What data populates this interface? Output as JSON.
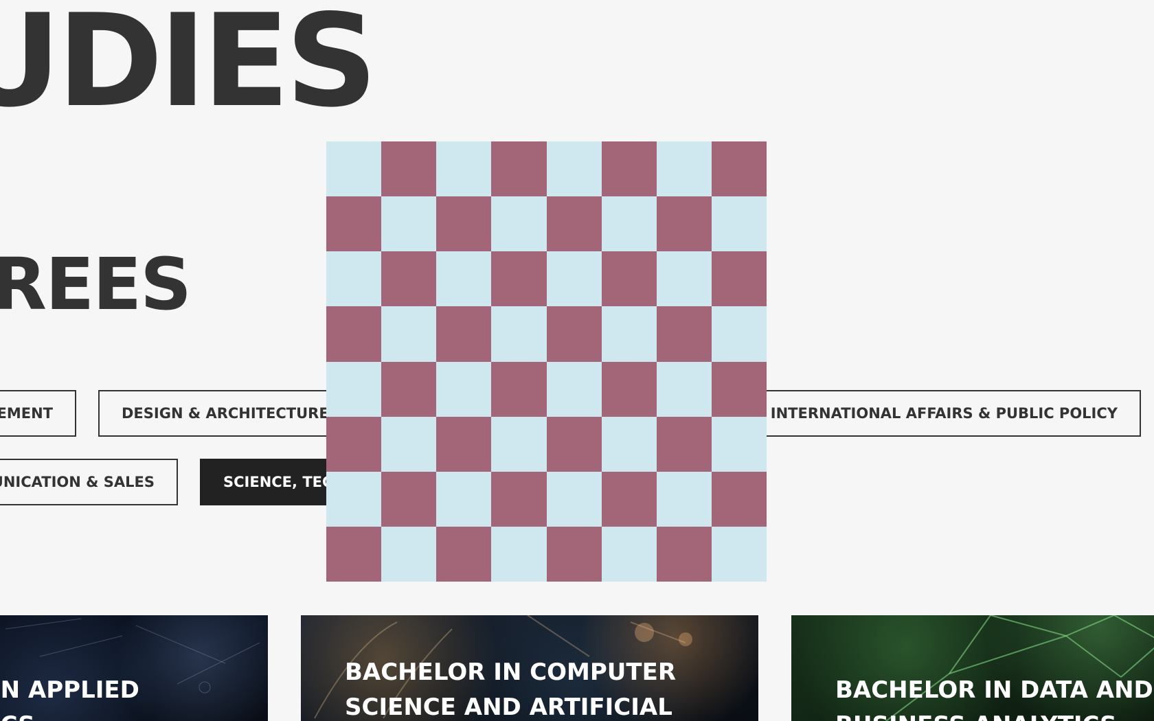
{
  "header": {
    "title": "UDIES"
  },
  "section": {
    "title": "REES"
  },
  "filters": {
    "management": "EMENT",
    "design": "DESIGN & ARCHITECTURE",
    "international": "INTERNATIONAL AFFAIRS & PUBLIC POLICY",
    "communication": "UNICATION & SALES",
    "science": "SCIENCE, TEC"
  },
  "overlay": {
    "colors": {
      "light": "#cfe8ef",
      "dark": "#a36679"
    }
  },
  "cards": [
    {
      "title_lines": [
        "IN APPLIED",
        "ICS"
      ]
    },
    {
      "title_lines": [
        "BACHELOR IN COMPUTER",
        "SCIENCE AND ARTIFICIAL"
      ]
    },
    {
      "title_lines": [
        "BACHELOR IN DATA AND",
        "BUSINESS ANALYTICS"
      ]
    }
  ]
}
